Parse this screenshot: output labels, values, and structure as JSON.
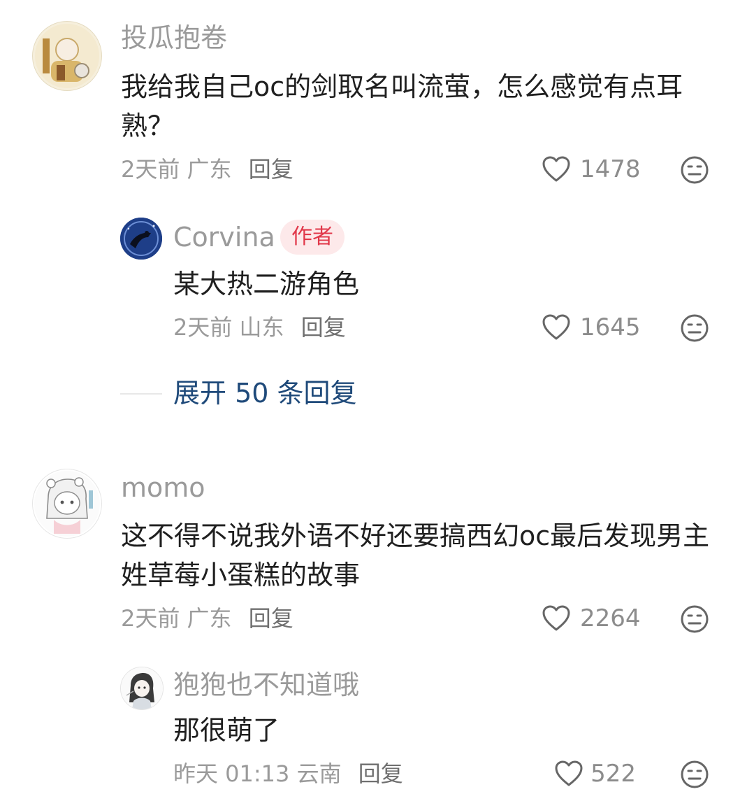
{
  "comments": [
    {
      "user": "投瓜抱卷",
      "text": "我给我自己oc的剑取名叫流萤，怎么感觉有点耳熟？",
      "time": "2天前",
      "location": "广东",
      "reply_label": "回复",
      "likes": "1478",
      "reply": {
        "user": "Corvina",
        "badge": "作者",
        "text": "某大热二游角色",
        "time": "2天前",
        "location": "山东",
        "reply_label": "回复",
        "likes": "1645"
      },
      "expand_label": "展开 50 条回复"
    },
    {
      "user": "momo",
      "text": "这不得不说我外语不好还要搞西幻oc最后发现男主姓草莓小蛋糕的故事",
      "time": "2天前",
      "location": "广东",
      "reply_label": "回复",
      "likes": "2264",
      "reply": {
        "user": "狍狍也不知道哦",
        "text": "那很萌了",
        "time": "昨天 01:13",
        "location": "云南",
        "reply_label": "回复",
        "likes": "522"
      }
    }
  ],
  "colors": {
    "accent_link": "#1f4a7a",
    "author_badge_text": "#e1384a",
    "author_badge_bg": "#fde9ea"
  },
  "icons": [
    "heart-icon",
    "dislike-face-icon"
  ]
}
